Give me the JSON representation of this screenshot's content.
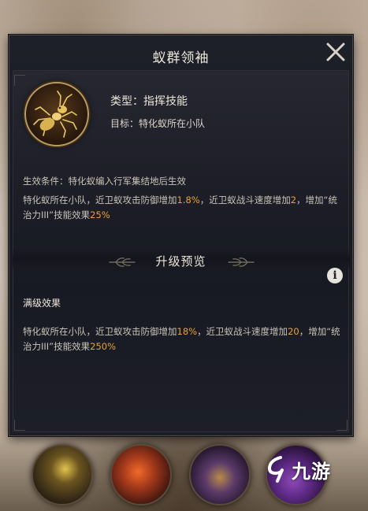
{
  "dialog": {
    "title": "蚁群领袖",
    "close_icon": "close-icon"
  },
  "skill": {
    "icon": "golden-ant-icon",
    "type_text": "类型：指挥技能",
    "target_text": "目标：特化蚁所在小队",
    "condition_text": "生效条件：特化蚁编入行军集结地后生效",
    "current_effect": {
      "p1": "特化蚁所在小队，近卫蚁攻击防御增加",
      "v1": "1.8%",
      "p2": "，近卫蚁战斗速度增加",
      "v2": "2",
      "p3": "，增加“统治力III”技能效果",
      "v3": "25%"
    }
  },
  "upgrade": {
    "section_title": "升级预览",
    "info_icon": "info-icon",
    "info_glyph": "i",
    "max_label": "满级效果",
    "max_effect": {
      "p1": "特化蚁所在小队，近卫蚁攻击防御增加",
      "v1": "18%",
      "p2": "，近卫蚁战斗速度增加",
      "v2": "20",
      "p3": "，增加“统治力III”技能效果",
      "v3": "250%"
    }
  },
  "bottom_skills": [
    "skill-icon-1",
    "skill-icon-2",
    "skill-icon-3",
    "skill-icon-4"
  ],
  "watermark": {
    "text": "九游"
  },
  "colors": {
    "highlight": "#e8a23a",
    "panel_bg": "#1c1d26",
    "text": "#c9c4b8",
    "title": "#ece6da"
  }
}
